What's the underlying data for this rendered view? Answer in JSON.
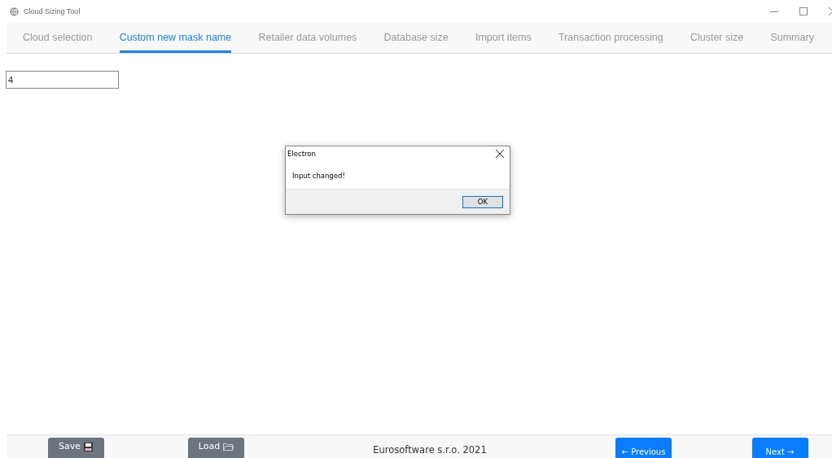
{
  "window": {
    "title": "Cloud Sizing Tool"
  },
  "tabs": [
    {
      "label": "Cloud selection",
      "selected": false
    },
    {
      "label": "Custom new mask name",
      "selected": true
    },
    {
      "label": "Retailer data volumes",
      "selected": false
    },
    {
      "label": "Database size",
      "selected": false
    },
    {
      "label": "Import items",
      "selected": false
    },
    {
      "label": "Transaction processing",
      "selected": false
    },
    {
      "label": "Cluster size",
      "selected": false
    },
    {
      "label": "Summary",
      "selected": false
    }
  ],
  "input": {
    "value": "4"
  },
  "dialog": {
    "title": "Electron",
    "message": "Input changed!",
    "button": "OK"
  },
  "footer": {
    "buttons": [
      {
        "label": "Save",
        "kind": "save"
      },
      {
        "label": "Load",
        "kind": "load"
      }
    ],
    "copyright": "Eurosoftware s.r.o. 2021",
    "nav": [
      {
        "label": "← Previous"
      },
      {
        "label": "Next →"
      }
    ]
  }
}
